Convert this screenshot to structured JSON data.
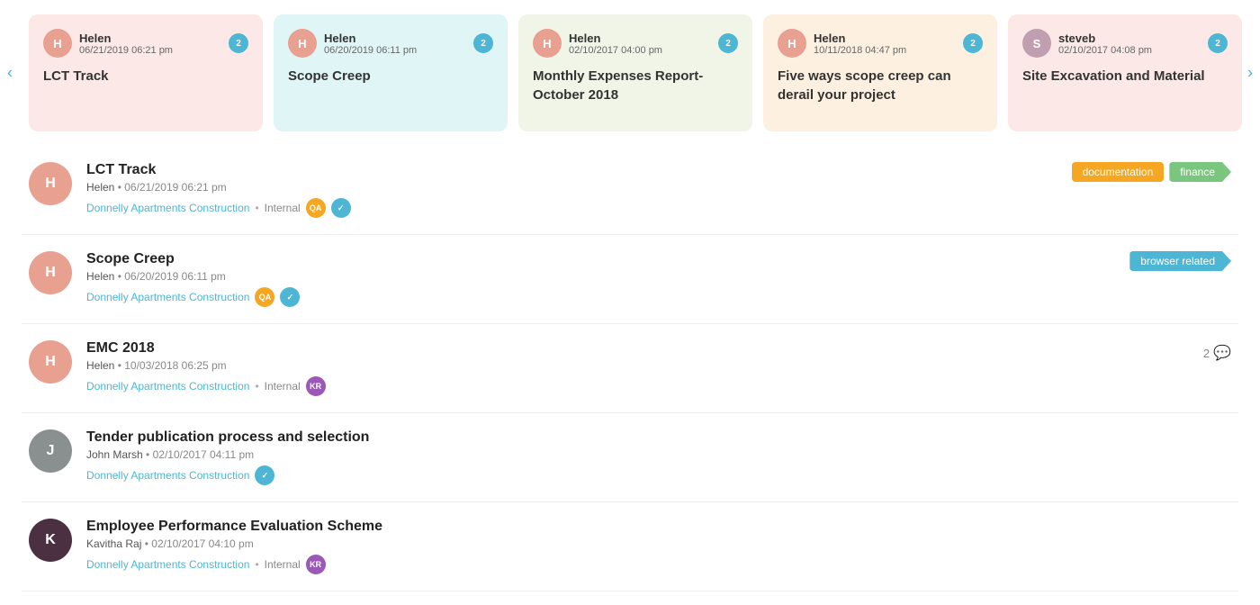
{
  "carousel": {
    "cards": [
      {
        "id": "card-1",
        "author": "Helen",
        "date": "06/21/2019 06:21 pm",
        "title": "LCT Track",
        "badge": "2",
        "color": "card-pink",
        "avatarColor": "#e8a090",
        "avatarInitial": "H"
      },
      {
        "id": "card-2",
        "author": "Helen",
        "date": "06/20/2019 06:11 pm",
        "title": "Scope Creep",
        "badge": "2",
        "color": "card-teal",
        "avatarColor": "#e8a090",
        "avatarInitial": "H"
      },
      {
        "id": "card-3",
        "author": "Helen",
        "date": "02/10/2017 04:00 pm",
        "title": "Monthly Expenses Report- October 2018",
        "badge": "2",
        "color": "card-olive",
        "avatarColor": "#e8a090",
        "avatarInitial": "H"
      },
      {
        "id": "card-4",
        "author": "Helen",
        "date": "10/11/2018 04:47 pm",
        "title": "Five ways scope creep can derail your project",
        "badge": "2",
        "color": "card-peach",
        "avatarColor": "#e8a090",
        "avatarInitial": "H"
      },
      {
        "id": "card-5",
        "author": "steveb",
        "date": "02/10/2017 04:08 pm",
        "title": "Site Excavation and Material",
        "badge": "2",
        "color": "card-lightpink",
        "avatarColor": "#c0a0b0",
        "avatarInitial": "S"
      }
    ]
  },
  "list": {
    "items": [
      {
        "id": "item-1",
        "title": "LCT Track",
        "author": "Helen",
        "date": "06/21/2019 06:21 pm",
        "project": "Donnelly Apartments Construction",
        "visibility": "Internal",
        "badges": [
          "QA",
          "teal"
        ],
        "tags": [
          {
            "label": "documentation",
            "type": "tag-doc"
          },
          {
            "label": "finance",
            "type": "tag-finance"
          }
        ],
        "avatarColor": "#e8a090",
        "avatarInitial": "H",
        "commentCount": null
      },
      {
        "id": "item-2",
        "title": "Scope Creep",
        "author": "Helen",
        "date": "06/20/2019 06:11 pm",
        "project": "Donnelly Apartments Construction",
        "visibility": null,
        "badges": [
          "QA",
          "teal-2"
        ],
        "tags": [
          {
            "label": "browser related",
            "type": "tag-browser"
          }
        ],
        "avatarColor": "#e8a090",
        "avatarInitial": "H",
        "commentCount": null
      },
      {
        "id": "item-3",
        "title": "EMC 2018",
        "author": "Helen",
        "date": "10/03/2018 06:25 pm",
        "project": "Donnelly Apartments Construction",
        "visibility": "Internal",
        "badges": [
          "purple"
        ],
        "tags": [],
        "avatarColor": "#e8a090",
        "avatarInitial": "H",
        "commentCount": "2"
      },
      {
        "id": "item-4",
        "title": "Tender publication process and selection",
        "author": "John Marsh",
        "date": "02/10/2017 04:11 pm",
        "project": "Donnelly Apartments Construction",
        "visibility": null,
        "badges": [
          "green-teal"
        ],
        "tags": [],
        "avatarColor": "#8a9090",
        "avatarInitial": "J",
        "commentCount": null
      },
      {
        "id": "item-5",
        "title": "Employee Performance Evaluation Scheme",
        "author": "Kavitha Raj",
        "date": "02/10/2017 04:10 pm",
        "project": "Donnelly Apartments Construction",
        "visibility": "Internal",
        "badges": [
          "purple-2"
        ],
        "tags": [],
        "avatarColor": "#4a3040",
        "avatarInitial": "K",
        "commentCount": null
      }
    ]
  },
  "ui": {
    "arrow_left": "‹",
    "arrow_right": "›",
    "dot_separator": "•",
    "comment_icon": "💬"
  }
}
